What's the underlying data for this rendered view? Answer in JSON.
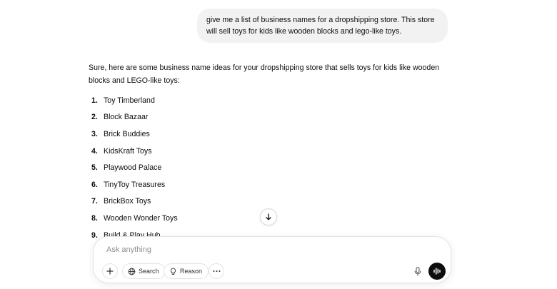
{
  "user_message": "give me a list of business names for a dropshipping store. This store will sell toys for kids like wooden blocks and lego-like toys.",
  "assistant": {
    "intro": "Sure, here are some business name ideas for your dropshipping store that sells toys for kids like wooden blocks and LEGO-like toys:",
    "items": [
      {
        "num": "1.",
        "name": "Toy Timberland"
      },
      {
        "num": "2.",
        "name": "Block Bazaar"
      },
      {
        "num": "3.",
        "name": "Brick Buddies"
      },
      {
        "num": "4.",
        "name": "KidsKraft Toys"
      },
      {
        "num": "5.",
        "name": "Playwood Palace"
      },
      {
        "num": "6.",
        "name": "TinyToy Treasures"
      },
      {
        "num": "7.",
        "name": "BrickBox Toys"
      },
      {
        "num": "8.",
        "name": "Wooden Wonder Toys"
      },
      {
        "num": "9.",
        "name": "Build & Play Hub"
      }
    ]
  },
  "composer": {
    "placeholder": "Ask anything",
    "value": "",
    "search_label": "Search",
    "reason_label": "Reason"
  },
  "icons": {
    "scroll": "arrow-down-icon",
    "add": "plus-icon",
    "search": "globe-icon",
    "reason": "lightbulb-icon",
    "more": "ellipsis-icon",
    "mic": "microphone-icon",
    "voice": "voice-waveform-icon"
  }
}
